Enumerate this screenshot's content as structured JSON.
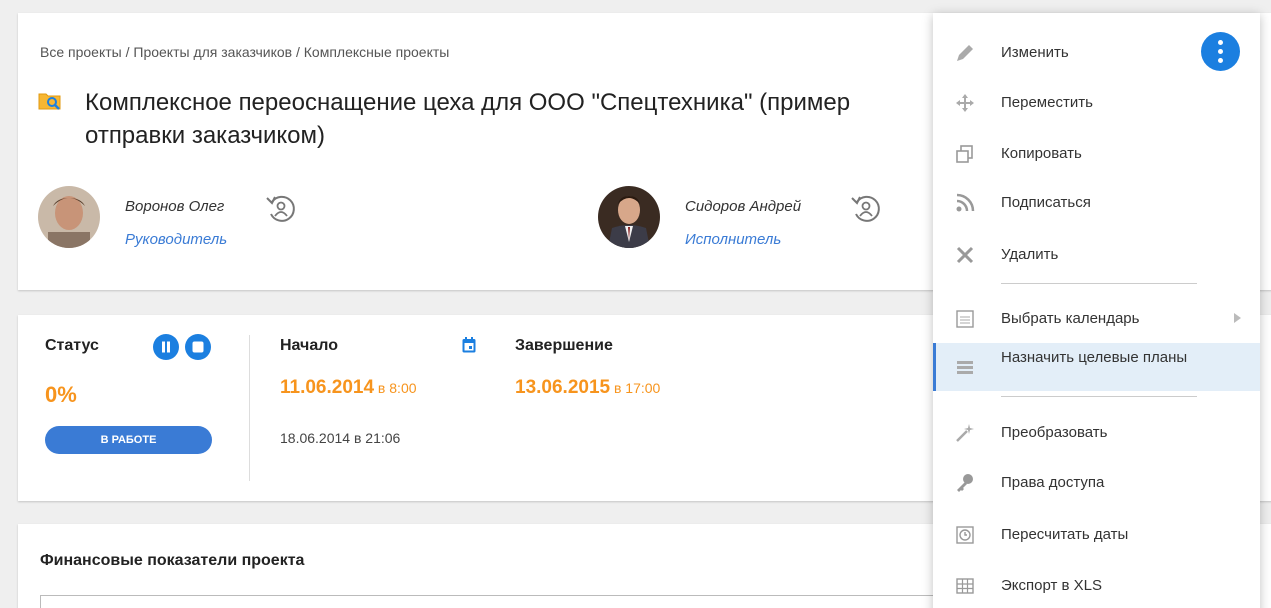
{
  "breadcrumb": {
    "items": [
      "Все проекты",
      "Проекты для заказчиков",
      "Комплексные проекты"
    ],
    "separator": " / "
  },
  "project": {
    "title": "Комплексное переоснащение цеха для ООО \"Спецтехника\" (пример отправки заказчиком)"
  },
  "people": [
    {
      "name": "Воронов Олег",
      "role": "Руководитель"
    },
    {
      "name": "Сидоров Андрей",
      "role": "Исполнитель"
    }
  ],
  "status": {
    "label": "Статус",
    "percent": "0%",
    "state": "В РАБОТЕ"
  },
  "dates": {
    "start_label": "Начало",
    "start_date": "11.06.2014",
    "start_time": " в 8:00",
    "end_label": "Завершение",
    "end_date": "13.06.2015",
    "end_time": " в 17:00",
    "created": "18.06.2014 в 21:06"
  },
  "finance": {
    "title": "Финансовые показатели проекта"
  },
  "menu": {
    "items": [
      {
        "label": "Изменить",
        "icon": "pencil-icon"
      },
      {
        "label": "Переместить",
        "icon": "move-icon"
      },
      {
        "label": "Копировать",
        "icon": "copy-icon"
      },
      {
        "label": "Подписаться",
        "icon": "rss-icon"
      },
      {
        "label": "Удалить",
        "icon": "close-icon"
      },
      {
        "label": "Выбрать календарь",
        "icon": "calendar-icon"
      },
      {
        "label": "Назначить целевые планы",
        "icon": "baseline-icon"
      },
      {
        "label": "Преобразовать",
        "icon": "magic-wand-icon"
      },
      {
        "label": "Права доступа",
        "icon": "key-icon"
      },
      {
        "label": "Пересчитать даты",
        "icon": "clock-icon"
      },
      {
        "label": "Экспорт в XLS",
        "icon": "table-icon"
      }
    ]
  },
  "colors": {
    "accent": "#3a7bd5",
    "button_blue": "#1b7fe0",
    "orange": "#f7941d",
    "active_bg": "#e3eef8"
  }
}
